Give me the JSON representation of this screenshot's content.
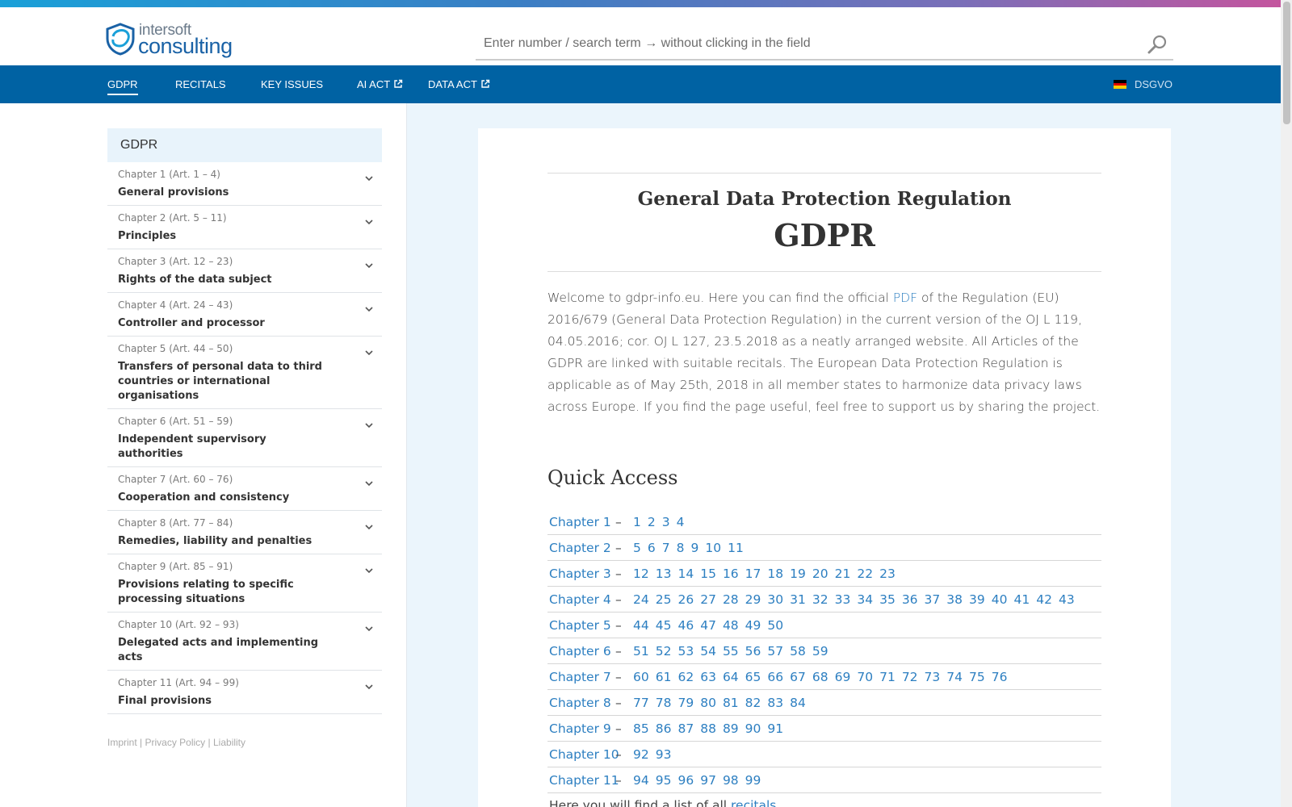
{
  "logo": {
    "small": "intersoft",
    "big": "consulting"
  },
  "search": {
    "placeholder": "Enter number / search term → without clicking in the field"
  },
  "nav": {
    "items": [
      {
        "label": "GDPR",
        "active": true
      },
      {
        "label": "RECITALS"
      },
      {
        "label": "KEY ISSUES"
      },
      {
        "label": "AI ACT",
        "external": true
      },
      {
        "label": "DATA ACT",
        "external": true
      }
    ],
    "language": "DSGVO"
  },
  "sidebar": {
    "heading": "GDPR",
    "chapters": [
      {
        "sub": "Chapter 1 (Art. 1 – 4)",
        "title": "General provisions"
      },
      {
        "sub": "Chapter 2 (Art. 5 – 11)",
        "title": "Principles"
      },
      {
        "sub": "Chapter 3 (Art. 12 – 23)",
        "title": "Rights of the data subject"
      },
      {
        "sub": "Chapter 4 (Art. 24 – 43)",
        "title": "Controller and processor"
      },
      {
        "sub": "Chapter 5 (Art. 44 – 50)",
        "title": "Transfers of personal data to third countries or international organisations"
      },
      {
        "sub": "Chapter 6 (Art. 51 – 59)",
        "title": "Independent supervisory authorities"
      },
      {
        "sub": "Chapter 7 (Art. 60 – 76)",
        "title": "Cooperation and consistency"
      },
      {
        "sub": "Chapter 8 (Art. 77 – 84)",
        "title": "Remedies, liability and penalties"
      },
      {
        "sub": "Chapter 9 (Art. 85 – 91)",
        "title": "Provisions relating to specific processing situations"
      },
      {
        "sub": "Chapter 10 (Art. 92 – 93)",
        "title": "Delegated acts and implementing acts"
      },
      {
        "sub": "Chapter 11 (Art. 94 – 99)",
        "title": "Final provisions"
      }
    ]
  },
  "footer": {
    "imprint": "Imprint",
    "privacy": "Privacy Policy",
    "liability": "Liability",
    "sep": "|"
  },
  "main": {
    "subtitle": "General Data Protection Regulation",
    "title": "GDPR",
    "intro_before": "Welcome to gdpr-info.eu. Here you can find the official ",
    "intro_link": "PDF",
    "intro_after": " of the Regulation (EU) 2016/679 (General Data Protection Regulation) in the current version of the OJ L 119, 04.05.2016; cor. OJ L 127, 23.5.2018 as a neatly arranged website. All Articles of the GDPR are linked with suitable recitals. The European Data Protection Regulation is applicable as of May 25th, 2018 in all member states to harmonize data privacy laws across Europe. If you find the page useful, feel free to support us by sharing the project.",
    "quick_access_title": "Quick Access",
    "dash": "–",
    "quick_access": [
      {
        "chapter": "Chapter 1",
        "articles": [
          "1",
          "2",
          "3",
          "4"
        ]
      },
      {
        "chapter": "Chapter 2",
        "articles": [
          "5",
          "6",
          "7",
          "8",
          "9",
          "10",
          "11"
        ]
      },
      {
        "chapter": "Chapter 3",
        "articles": [
          "12",
          "13",
          "14",
          "15",
          "16",
          "17",
          "18",
          "19",
          "20",
          "21",
          "22",
          "23"
        ]
      },
      {
        "chapter": "Chapter 4",
        "articles": [
          "24",
          "25",
          "26",
          "27",
          "28",
          "29",
          "30",
          "31",
          "32",
          "33",
          "34",
          "35",
          "36",
          "37",
          "38",
          "39",
          "40",
          "41",
          "42",
          "43"
        ]
      },
      {
        "chapter": "Chapter 5",
        "articles": [
          "44",
          "45",
          "46",
          "47",
          "48",
          "49",
          "50"
        ]
      },
      {
        "chapter": "Chapter 6",
        "articles": [
          "51",
          "52",
          "53",
          "54",
          "55",
          "56",
          "57",
          "58",
          "59"
        ]
      },
      {
        "chapter": "Chapter 7",
        "articles": [
          "60",
          "61",
          "62",
          "63",
          "64",
          "65",
          "66",
          "67",
          "68",
          "69",
          "70",
          "71",
          "72",
          "73",
          "74",
          "75",
          "76"
        ]
      },
      {
        "chapter": "Chapter 8",
        "articles": [
          "77",
          "78",
          "79",
          "80",
          "81",
          "82",
          "83",
          "84"
        ]
      },
      {
        "chapter": "Chapter 9",
        "articles": [
          "85",
          "86",
          "87",
          "88",
          "89",
          "90",
          "91"
        ]
      },
      {
        "chapter": "Chapter 10",
        "articles": [
          "92",
          "93"
        ]
      },
      {
        "chapter": "Chapter 11",
        "articles": [
          "94",
          "95",
          "96",
          "97",
          "98",
          "99"
        ]
      }
    ],
    "bottom_before": "Here you will find a list of all ",
    "bottom_link": "recitals"
  },
  "colors": {
    "brand_blue": "#0062a3",
    "link": "#2d7fc1",
    "panel": "#ebf5fc"
  },
  "icons": {
    "search": "search-icon",
    "chevron": "chevron-down-icon",
    "external": "external-link-icon",
    "flag": "german-flag-icon"
  }
}
